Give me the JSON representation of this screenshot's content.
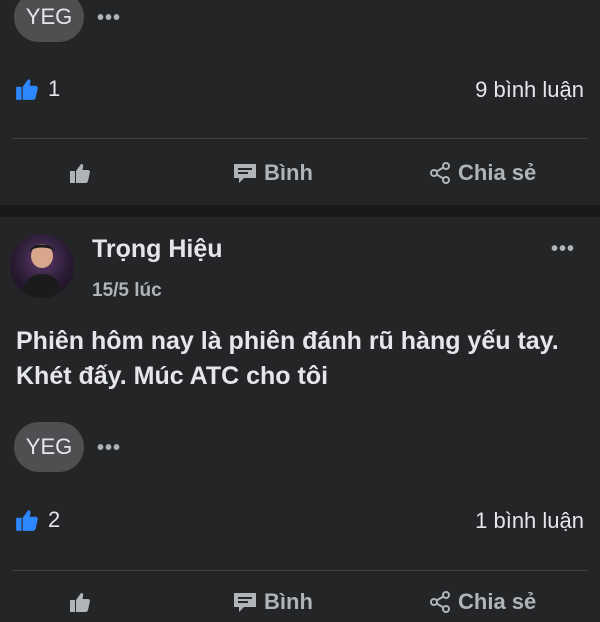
{
  "post1": {
    "tag": "YEG",
    "likes": "1",
    "comments": "9 bình luận",
    "actions": {
      "like": "",
      "comment": "Bình",
      "share": "Chia sẻ"
    }
  },
  "post2": {
    "author": "Trọng Hiệu",
    "time": "15/5 lúc",
    "body": "Phiên hôm nay là phiên đánh rũ hàng yếu tay. Khét đấy. Múc ATC cho tôi",
    "tag": "YEG",
    "likes": "2",
    "comments": "1 bình luận",
    "actions": {
      "like": "",
      "comment": "Bình",
      "share": "Chia sẻ"
    }
  },
  "icons": {
    "more": "more-horizontal-icon",
    "like": "thumbs-up-icon",
    "comment": "comment-icon",
    "share": "share-icon"
  },
  "colors": {
    "background": "#242526",
    "separator": "#18191a",
    "like_blue": "#2d88ff",
    "muted": "#b0b3b8",
    "text": "#e4e6eb"
  }
}
